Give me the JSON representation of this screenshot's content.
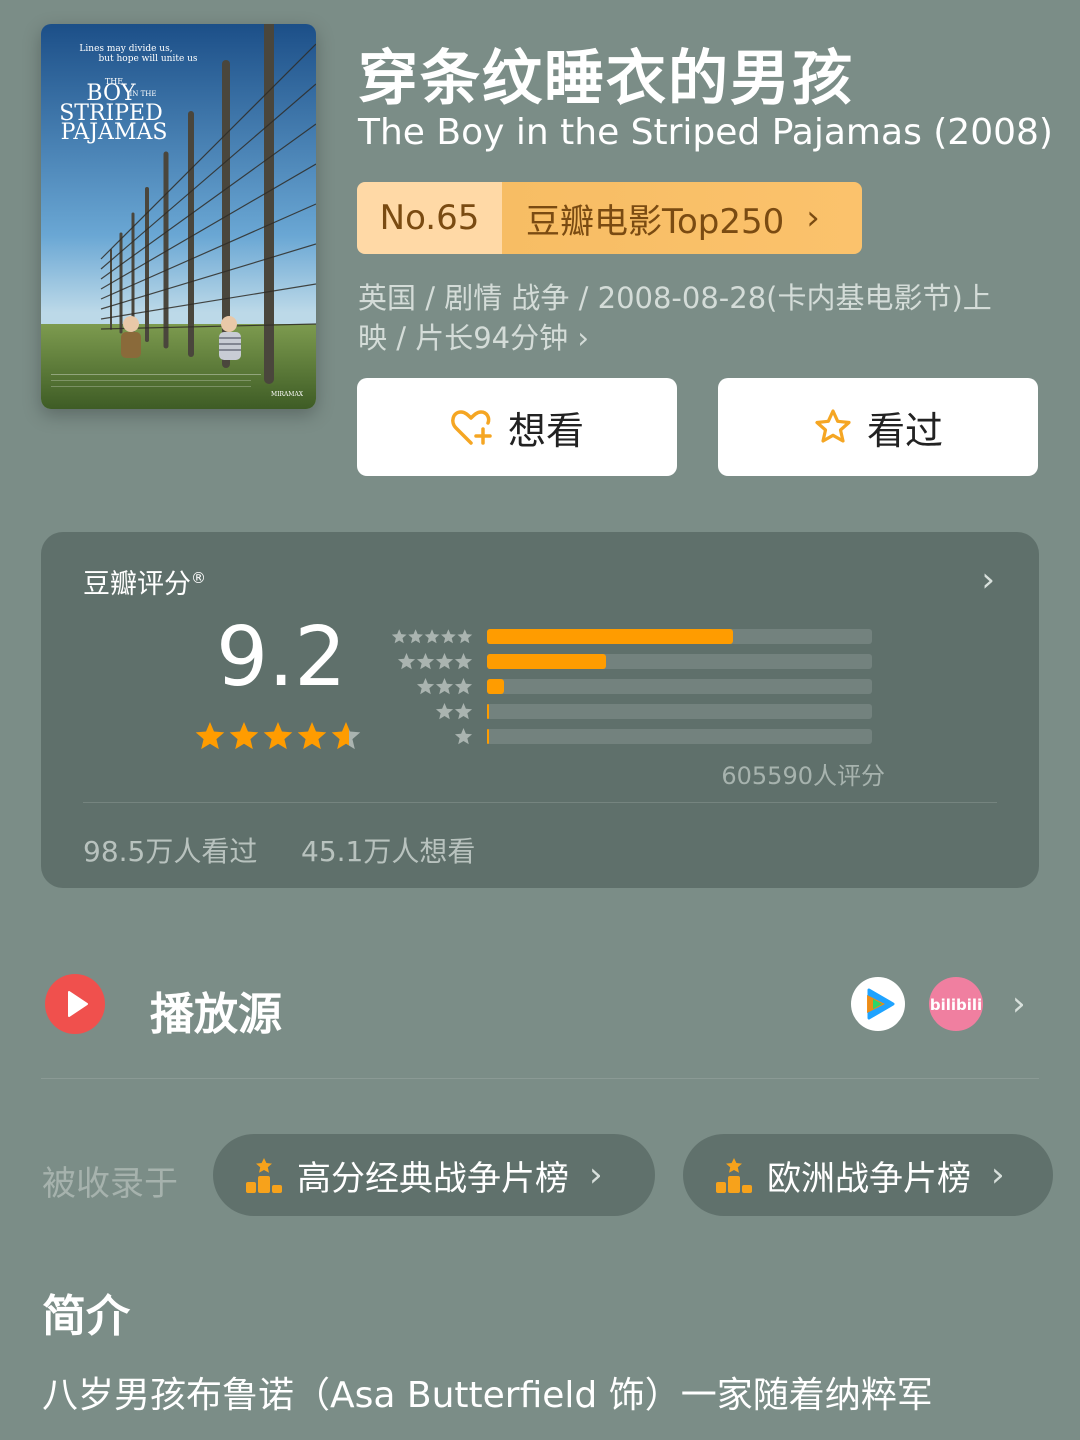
{
  "poster": {
    "tagline_line1": "Lines may divide us,",
    "tagline_line2": "but hope will unite us",
    "title_the": "THE",
    "title_boy": "BOY",
    "title_in_the": "IN THE",
    "title_striped": "STRIPED",
    "title_pajamas": "PAJAMAS",
    "studio": "MIRAMAX"
  },
  "movie": {
    "title_cn": "穿条纹睡衣的男孩",
    "title_en": "The Boy in the Striped Pajamas (2008)",
    "rank_no": "No.65",
    "rank_list": "豆瓣电影Top250",
    "meta_line1": "英国 / 剧情 战争 / 2008-08-28(卡内基电影节)上",
    "meta_line2": "映 / 片长94分钟 ›"
  },
  "actions": {
    "want_label": "想看",
    "seen_label": "看过"
  },
  "rating": {
    "title": "豆瓣评分",
    "registered": "®",
    "score": "9.2",
    "score_value": 9.2,
    "distribution": [
      {
        "stars": 5,
        "fraction": 0.64
      },
      {
        "stars": 4,
        "fraction": 0.31
      },
      {
        "stars": 3,
        "fraction": 0.045
      },
      {
        "stars": 2,
        "fraction": 0.004
      },
      {
        "stars": 1,
        "fraction": 0.002
      }
    ],
    "count": "605590人评分",
    "seen": "98.5万人看过",
    "wish": "45.1万人想看"
  },
  "play": {
    "title": "播放源",
    "sources": [
      "tencent-video-icon",
      "bilibili-icon"
    ],
    "bili_text": "bilibili"
  },
  "collections": {
    "label": "被收录于",
    "items": [
      {
        "label": "高分经典战争片榜"
      },
      {
        "label": "欧洲战争片榜"
      }
    ]
  },
  "intro": {
    "title": "简介",
    "text": "八岁男孩布鲁诺（Asa Butterfield 饰）一家随着纳粹军"
  },
  "colors": {
    "background": "#7b8d87",
    "card": "#5f706b",
    "accent_orange": "#ff9c00",
    "rank_gold": "#f7bd64",
    "play_red": "#f0504d"
  }
}
